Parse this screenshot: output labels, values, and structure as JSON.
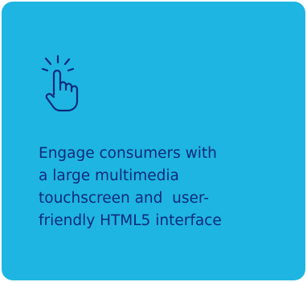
{
  "card": {
    "icon": "pointer-hand-touch-icon",
    "text_lines": [
      "Engage consumers with",
      "a large multimedia",
      "touchscreen and  user-",
      "friendly HTML5 interface"
    ],
    "colors": {
      "background": "#1eb5e2",
      "text": "#0d2a7a",
      "icon": "#0d2a7a"
    }
  }
}
